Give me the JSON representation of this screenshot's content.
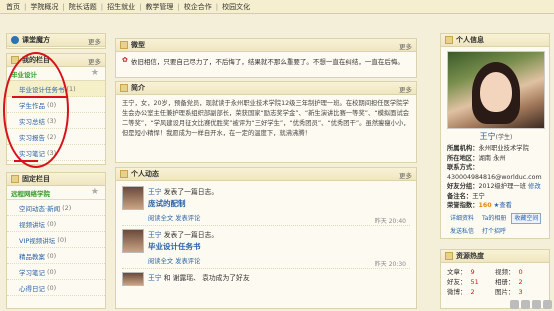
{
  "nav": [
    "首页",
    "学院概况",
    "院长话题",
    "招生就业",
    "教学管理",
    "校企合作",
    "校园文化"
  ],
  "class_panel": {
    "title": "课堂魔方",
    "more": "更多"
  },
  "my_column": {
    "title": "我的栏目",
    "more": "更多",
    "category": "毕业设计",
    "items": [
      {
        "label": "毕业设计任务书",
        "count": "(1)"
      },
      {
        "label": "学生作品",
        "count": "(0)"
      },
      {
        "label": "实习总结",
        "count": "(3)"
      },
      {
        "label": "实习报告",
        "count": "(2)"
      },
      {
        "label": "实习笔记",
        "count": "(3)"
      }
    ]
  },
  "fixed_column": {
    "title": "固定栏目",
    "category": "远程网络学院",
    "items": [
      {
        "label": "空间动态·新闻",
        "count": "(2)"
      },
      {
        "label": "视频讲坛",
        "count": "(0)"
      },
      {
        "label": "VIP视频讲坛",
        "count": "(0)"
      },
      {
        "label": "精品教案",
        "count": "(0)"
      },
      {
        "label": "学习笔记",
        "count": "(0)"
      },
      {
        "label": "心得日记",
        "count": "(0)"
      }
    ]
  },
  "mood": {
    "title": "微型",
    "more": "更多",
    "text": "依旧相信，只要自己尽力了，不后悔了，结果就不那么重要了。不想一直在纠结，一直在后悔。"
  },
  "intro": {
    "title": "简介",
    "more": "更多",
    "text": "王宁，女，20岁，预备党员，现就读于永州职业技术学院12级三年制护理一班。在校期间担任医学院学生会办公室主任兼护理系组织部副部长，荣获国家“励志奖学金”、“新生演讲比赛一等奖”、“模拟面试会二等奖”，“学风建设月征文比赛优胜奖”被评为“三好学生”，“优秀团员”、“优秀团干”。虽然瘦瘦小小，但是短小精悍！我愿成为一样自开水，在一定的温度下，就沸沸腾！"
  },
  "dynamics": {
    "title": "个人动态",
    "more": "更多",
    "items": [
      {
        "user": "王宁",
        "action": "发表了一篇日志。",
        "title": "庞试的配制",
        "time": "昨天 20:40",
        "links": "阅读全文  发表评论"
      },
      {
        "user": "王宁",
        "action": "发表了一篇日志。",
        "title": "毕业设计任务书",
        "time": "昨天 20:30",
        "links": "阅读全文  发表评论"
      },
      {
        "user": "王宁",
        "action": "和 谢露瑶、 袁功成为了好友",
        "title": "",
        "time": "",
        "links": ""
      }
    ]
  },
  "profile": {
    "title": "个人信息",
    "more": "更多",
    "name": "王宁",
    "role": "(学生)",
    "school_label": "所属机构：",
    "school": "永州职业技术学院",
    "region_label": "所在地区：",
    "region": "湖南 永州",
    "contact_label": "联系方式：",
    "contact": "430004984816@worlduc.com",
    "class_label": "好友分组：",
    "class_value": "2012级护理一班",
    "class_extra": "修改",
    "name_label": "备注名：",
    "name_value": "王宁",
    "honor_label": "荣誉指数：",
    "honor_value": "160",
    "honor_link": "查看",
    "buttons": [
      "详细资料",
      "Ta的相册",
      "收藏空间"
    ],
    "buttons2": [
      "发送私信",
      "打个招呼"
    ]
  },
  "resource": {
    "title": "资源热度",
    "more": "更多",
    "rows": [
      {
        "a_label": "文章：",
        "a_val": "9",
        "b_label": "视频：",
        "b_val": "0"
      },
      {
        "a_label": "好友：",
        "a_val": "51",
        "b_label": "相册：",
        "b_val": "2"
      },
      {
        "a_label": "微博：",
        "a_val": "2",
        "b_label": "图片：",
        "b_val": "3"
      }
    ]
  }
}
